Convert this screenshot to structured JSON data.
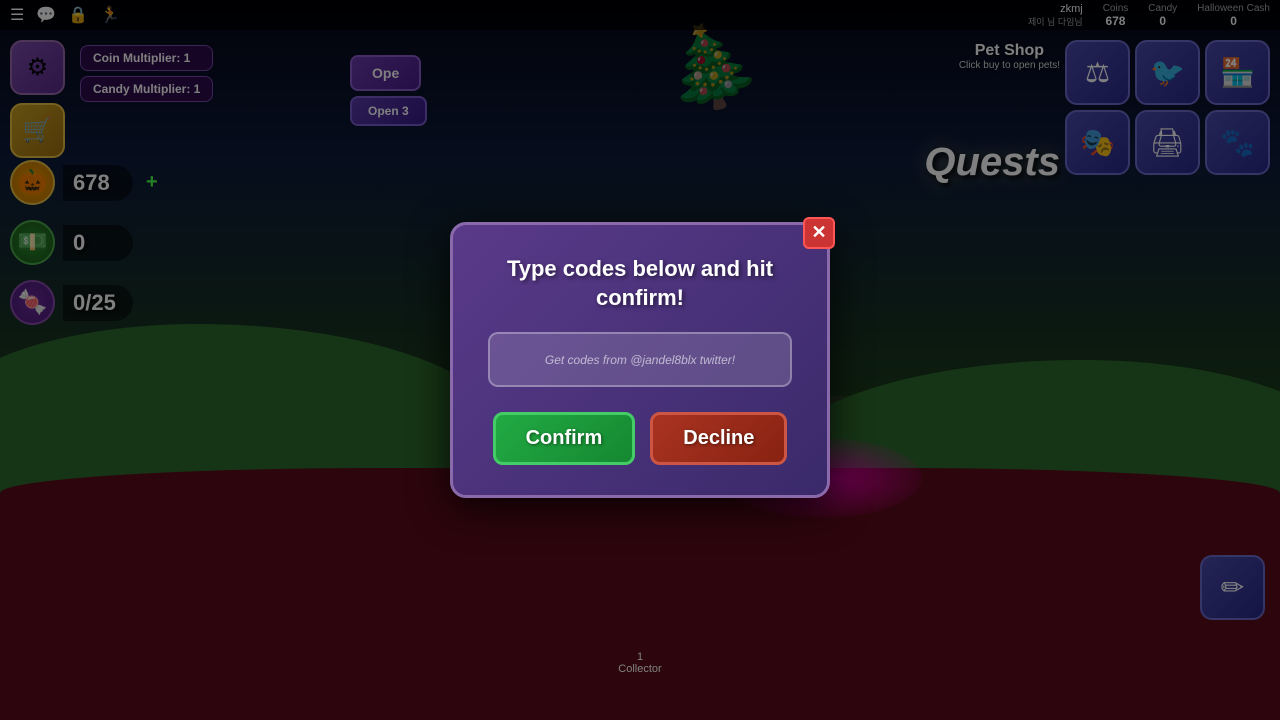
{
  "topbar": {
    "player_name": "zkmj",
    "player_sub": "제이 님 다임님",
    "coins_label": "Coins",
    "coins_value": "678",
    "candy_label": "Candy",
    "candy_value": "0",
    "halloween_label": "Halloween Cash",
    "halloween_value": "0"
  },
  "hud": {
    "settings_icon": "⚙",
    "shop_icon": "🛒",
    "coin_multiplier_label": "Coin Multiplier: 1",
    "candy_multiplier_label": "Candy Multiplier: 1",
    "coin_icon": "🎃",
    "coins_value": "678",
    "money_icon": "💵",
    "money_value": "0",
    "candy_icon": "🍬",
    "candy_value": "0/25",
    "plus_icon": "+",
    "open_label": "Ope",
    "open3_label": "Open 3"
  },
  "right_hud": {
    "pet_shop_label": "Pet Shop",
    "pet_shop_sub": "Click buy to open pets!",
    "quests_label": "Quests",
    "btn1_icon": "⚖",
    "btn2_icon": "🐦",
    "btn3_icon": "🏪",
    "btn4_icon": "🎭",
    "btn5_icon": "🖨",
    "btn6_icon": "🐾",
    "pencil_icon": "✏"
  },
  "bottom": {
    "label_number": "1",
    "label_text": "Collector"
  },
  "dialog": {
    "title": "Type codes below and hit confirm!",
    "input_placeholder": "Get codes from @jandel8blx twitter!",
    "confirm_label": "Confirm",
    "decline_label": "Decline",
    "close_icon": "✕"
  }
}
